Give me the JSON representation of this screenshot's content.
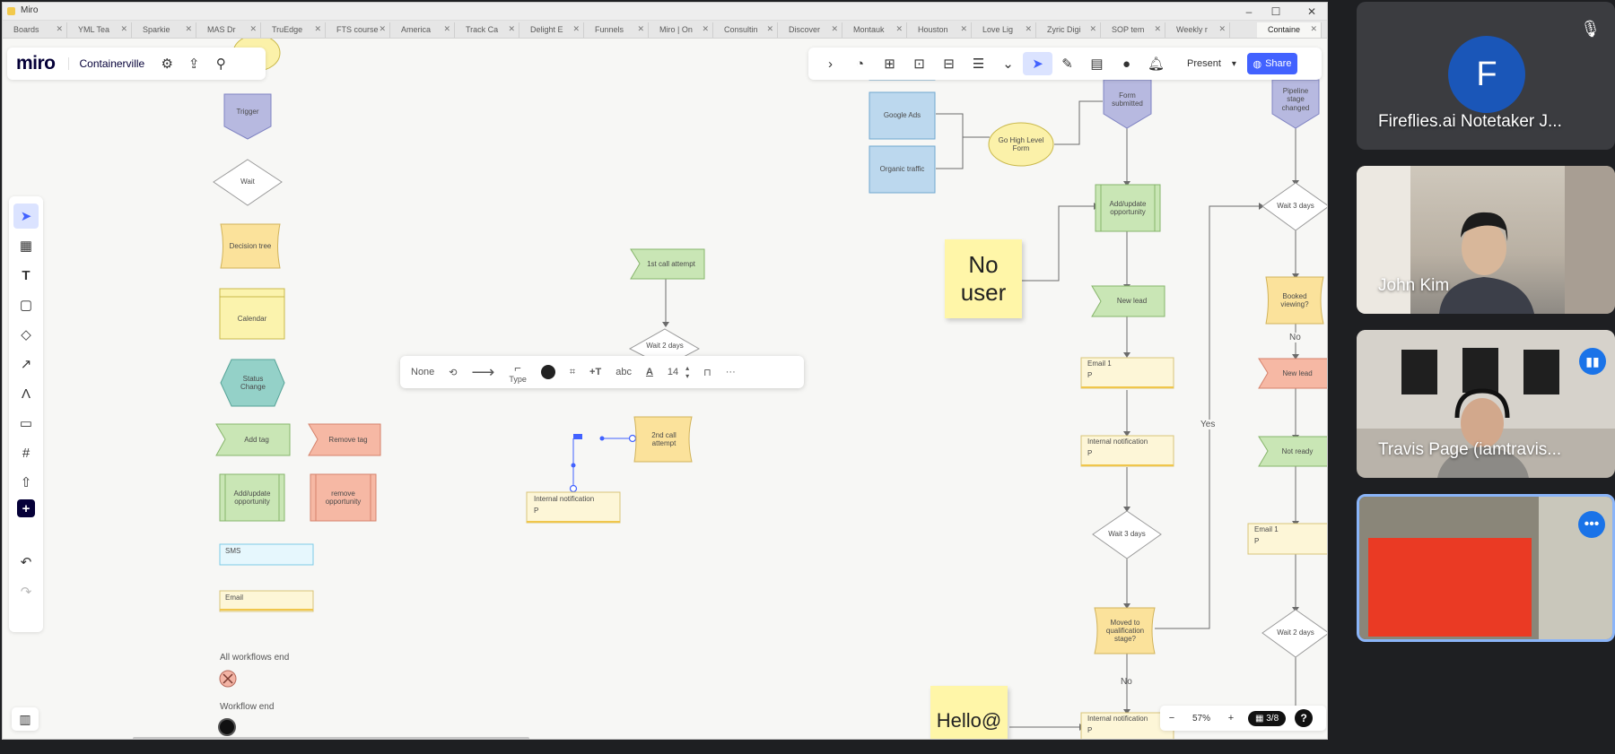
{
  "window": {
    "title": "Miro",
    "controls": [
      "–",
      "☐",
      "✕"
    ],
    "tabs": [
      "Boards",
      "YML Tea",
      "Sparkie",
      "MAS Dr",
      "TruEdge",
      "FTS course",
      "America",
      "Track Ca",
      "Delight E",
      "Funnels",
      "Miro | On",
      "Consultin",
      "Discover",
      "Montauk",
      "Houston",
      "Love Lig",
      "Zyric Digi",
      "SOP tem",
      "Weekly r",
      "Containe"
    ]
  },
  "miro": {
    "logo": "miro",
    "board_name": "Containerville"
  },
  "right_toolbar": {
    "present_label": "Present",
    "share_label": "Share"
  },
  "context_toolbar": {
    "line_start": "None",
    "type_label": "Type",
    "font_size": "14"
  },
  "zoom": {
    "minus": "−",
    "level": "57%",
    "plus": "+",
    "pages": "3/8",
    "help": "?"
  },
  "palette": {
    "trigger": "Trigger",
    "wait": "Wait",
    "decision_tree": "Decision tree",
    "calendar": "Calendar",
    "status_change": "Status Change",
    "add_tag": "Add tag",
    "remove_tag": "Remove tag",
    "add_update_opportunity": "Add/update opportunity",
    "remove_opportunity": "remove opportunity",
    "sms": "SMS",
    "email": "Email",
    "all_workflows_end": "All workflows end",
    "workflow_end": "Workflow end"
  },
  "flow_middle": {
    "first_call": "1st call attempt",
    "wait_2_days": "Wait 2 days",
    "second_call": "2nd call attempt",
    "internal_notification": "Internal notification",
    "p": "P"
  },
  "flow_right": {
    "google_ads": "Google Ads",
    "organic_traffic": "Organic traffic",
    "go_high_level_form": "Go High Level Form",
    "form_submitted": "Form submitted",
    "add_update_opportunity": "Add/update opportunity",
    "new_lead": "New lead",
    "email_1": "Email 1",
    "internal_notification": "Internal notification",
    "wait_3_days": "Wait 3 days",
    "moved_to_qualification": "Moved to qualification stage?",
    "no": "No",
    "yes": "Yes",
    "internal_notification_bottom": "Internal notification",
    "p": "P",
    "pipeline_stage_changed": "Pipeline stage changed",
    "wait_3_days_b": "Wait 3 days",
    "booked_viewing": "Booked viewing?",
    "no_b": "No",
    "new_lead_b": "New lead",
    "not_ready": "Not ready",
    "email_1_b": "Email 1",
    "wait_2_days_b": "Wait 2 days"
  },
  "stickies": {
    "no_user": "No user",
    "hello": "Hello@"
  },
  "participants": [
    {
      "name": "Fireflies.ai Notetaker J...",
      "initial": "F"
    },
    {
      "name": "John Kim"
    },
    {
      "name": "Travis Page (iamtravis..."
    },
    {
      "name": ""
    }
  ],
  "colors": {
    "miro_blue": "#4262ff",
    "sticky_yellow": "#fff6a8",
    "avatar_blue": "#1a56b8",
    "redaction_red": "#ea3a24"
  }
}
